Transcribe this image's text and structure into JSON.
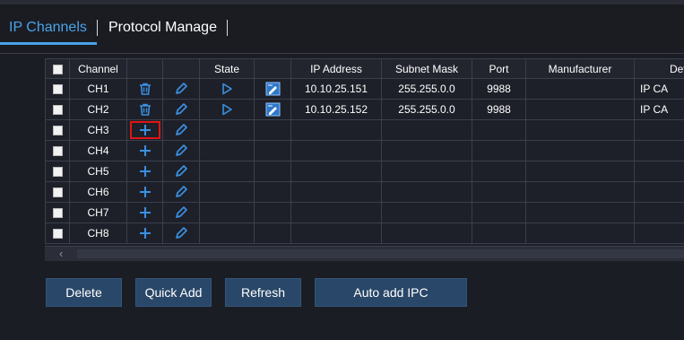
{
  "tabs": [
    {
      "label": "IP Channels"
    },
    {
      "label": "Protocol Manage"
    }
  ],
  "table": {
    "headers": [
      "",
      "Channel",
      "",
      "",
      "State",
      "",
      "IP Address",
      "Subnet Mask",
      "Port",
      "Manufacturer",
      "Devi"
    ],
    "rows": [
      {
        "channel": "CH1",
        "added": true,
        "ip": "10.10.25.151",
        "mask": "255.255.0.0",
        "port": "9988",
        "manufacturer": "",
        "device": "IP CA"
      },
      {
        "channel": "CH2",
        "added": true,
        "ip": "10.10.25.152",
        "mask": "255.255.0.0",
        "port": "9988",
        "manufacturer": "",
        "device": "IP CA"
      },
      {
        "channel": "CH3",
        "added": false,
        "ip": "",
        "mask": "",
        "port": "",
        "manufacturer": "",
        "device": ""
      },
      {
        "channel": "CH4",
        "added": false,
        "ip": "",
        "mask": "",
        "port": "",
        "manufacturer": "",
        "device": ""
      },
      {
        "channel": "CH5",
        "added": false,
        "ip": "",
        "mask": "",
        "port": "",
        "manufacturer": "",
        "device": ""
      },
      {
        "channel": "CH6",
        "added": false,
        "ip": "",
        "mask": "",
        "port": "",
        "manufacturer": "",
        "device": ""
      },
      {
        "channel": "CH7",
        "added": false,
        "ip": "",
        "mask": "",
        "port": "",
        "manufacturer": "",
        "device": ""
      },
      {
        "channel": "CH8",
        "added": false,
        "ip": "",
        "mask": "",
        "port": "",
        "manufacturer": "",
        "device": ""
      }
    ]
  },
  "buttons": {
    "delete": "Delete",
    "quick_add": "Quick Add",
    "refresh": "Refresh",
    "auto_add": "Auto add IPC"
  },
  "scrollbar": {
    "arrow_glyph": "‹"
  },
  "icons": {
    "delete": "trash-icon",
    "add": "plus-icon",
    "edit": "pencil-icon",
    "play": "play-icon",
    "config": "edit-settings-icon"
  },
  "colors": {
    "accent": "#4aa3e8",
    "background": "#1b1d24",
    "button": "#294768",
    "highlight": "#e21414"
  }
}
